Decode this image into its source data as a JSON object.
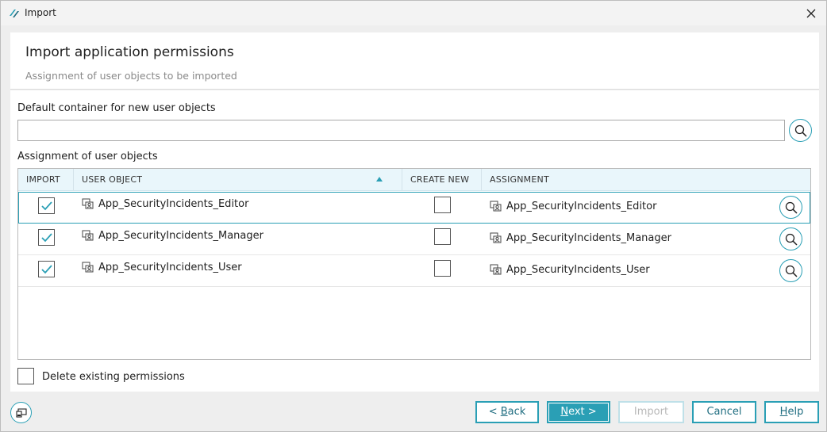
{
  "window": {
    "title": "Import"
  },
  "header": {
    "title": "Import application permissions",
    "subtitle": "Assignment of user objects to be imported"
  },
  "container": {
    "label": "Default container for new user objects",
    "value": "",
    "placeholder": ""
  },
  "assignment": {
    "label": "Assignment of user objects",
    "columns": {
      "import": "IMPORT",
      "user_object": "USER OBJECT",
      "create_new": "CREATE NEW",
      "assignment": "ASSIGNMENT"
    },
    "sort": {
      "column": "user_object",
      "direction": "ascending"
    },
    "rows": [
      {
        "import": true,
        "user_object": "App_SecurityIncidents_Editor",
        "create_new": false,
        "assignment": "App_SecurityIncidents_Editor",
        "selected": true
      },
      {
        "import": true,
        "user_object": "App_SecurityIncidents_Manager",
        "create_new": false,
        "assignment": "App_SecurityIncidents_Manager",
        "selected": false
      },
      {
        "import": true,
        "user_object": "App_SecurityIncidents_User",
        "create_new": false,
        "assignment": "App_SecurityIncidents_User",
        "selected": false
      }
    ]
  },
  "delete_existing": {
    "label": "Delete existing permissions",
    "checked": false
  },
  "buttons": {
    "back": {
      "pre": "< ",
      "accel": "B",
      "post": "ack"
    },
    "next": {
      "accel": "N",
      "post": "ext >"
    },
    "import": "Import",
    "cancel": "Cancel",
    "help": {
      "accel": "H",
      "post": "elp"
    }
  },
  "colors": {
    "accent": "#2a9fb5",
    "header_bg": "#e9f6fb"
  },
  "icons": {
    "app": "app-logo-icon",
    "close": "close-icon",
    "search": "magnifier-icon",
    "user_object": "user-group-icon",
    "bottom_left": "window-panel-icon"
  }
}
